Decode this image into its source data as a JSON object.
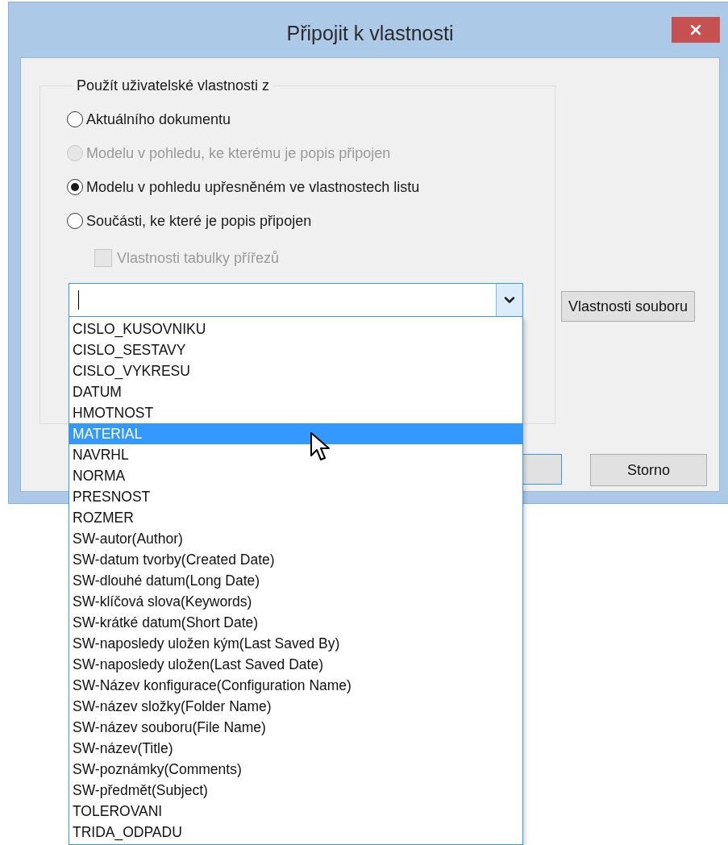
{
  "window": {
    "title": "Připojit k vlastnosti"
  },
  "group": {
    "label": "Použít uživatelské vlastnosti z",
    "options": [
      {
        "label": "Aktuálního dokumentu",
        "selected": false,
        "disabled": false
      },
      {
        "label": "Modelu v pohledu, ke kterému je popis připojen",
        "selected": false,
        "disabled": true
      },
      {
        "label": "Modelu v pohledu upřesněném ve vlastnostech listu",
        "selected": true,
        "disabled": false
      },
      {
        "label": "Součásti, ke které je popis připojen",
        "selected": false,
        "disabled": false
      }
    ],
    "checkbox": {
      "label": "Vlastnosti tabulky přířezů",
      "checked": false,
      "disabled": true
    }
  },
  "combo": {
    "expanded": true,
    "items": [
      {
        "label": "CISLO_KUSOVNIKU",
        "selected": false
      },
      {
        "label": "CISLO_SESTAVY",
        "selected": false
      },
      {
        "label": "CISLO_VYKRESU",
        "selected": false
      },
      {
        "label": "DATUM",
        "selected": false
      },
      {
        "label": "HMOTNOST",
        "selected": false
      },
      {
        "label": "MATERIAL",
        "selected": true
      },
      {
        "label": "NAVRHL",
        "selected": false
      },
      {
        "label": "NORMA",
        "selected": false
      },
      {
        "label": "PRESNOST",
        "selected": false
      },
      {
        "label": "ROZMER",
        "selected": false
      },
      {
        "label": "SW-autor(Author)",
        "selected": false
      },
      {
        "label": "SW-datum tvorby(Created Date)",
        "selected": false
      },
      {
        "label": "SW-dlouhé datum(Long Date)",
        "selected": false
      },
      {
        "label": "SW-klíčová slova(Keywords)",
        "selected": false
      },
      {
        "label": "SW-krátké datum(Short Date)",
        "selected": false
      },
      {
        "label": "SW-naposledy uložen kým(Last Saved By)",
        "selected": false
      },
      {
        "label": "SW-naposledy uložen(Last Saved Date)",
        "selected": false
      },
      {
        "label": "SW-Název konfigurace(Configuration Name)",
        "selected": false
      },
      {
        "label": "SW-název složky(Folder Name)",
        "selected": false
      },
      {
        "label": "SW-název souboru(File Name)",
        "selected": false
      },
      {
        "label": "SW-název(Title)",
        "selected": false
      },
      {
        "label": "SW-poznámky(Comments)",
        "selected": false
      },
      {
        "label": "SW-předmět(Subject)",
        "selected": false
      },
      {
        "label": "TOLEROVANI",
        "selected": false
      },
      {
        "label": "TRIDA_ODPADU",
        "selected": false
      }
    ]
  },
  "buttons": {
    "file_properties": "Vlastnosti souboru",
    "cancel": "Storno"
  }
}
